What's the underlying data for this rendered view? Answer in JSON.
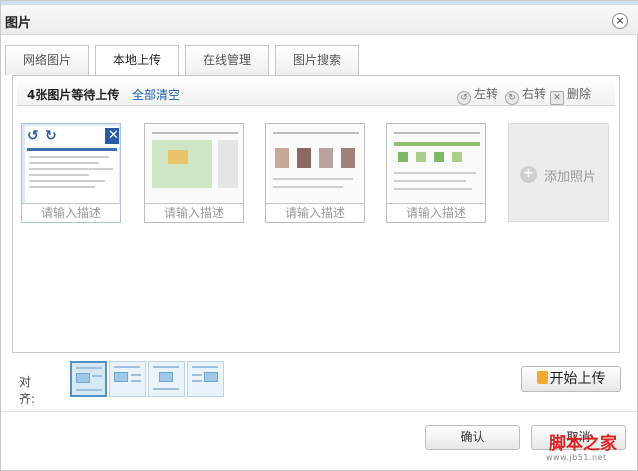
{
  "dialog": {
    "title": "图片",
    "close_glyph": "×"
  },
  "tabs": [
    {
      "label": "网络图片",
      "active": false
    },
    {
      "label": "本地上传",
      "active": true
    },
    {
      "label": "在线管理",
      "active": false
    },
    {
      "label": "图片搜索",
      "active": false
    }
  ],
  "toolbar": {
    "count_text": "4张图片等待上传",
    "clear_label": "全部清空",
    "left_rotate_label": "左转",
    "right_rotate_label": "右转",
    "delete_label": "删除"
  },
  "thumbnails": [
    {
      "placeholder": "请输入描述",
      "selected": true
    },
    {
      "placeholder": "请输入描述",
      "selected": false
    },
    {
      "placeholder": "请输入描述",
      "selected": false
    },
    {
      "placeholder": "请输入描述",
      "selected": false
    }
  ],
  "add_photo": {
    "label": "添加照片",
    "icon": "plus-icon"
  },
  "align": {
    "label": "对 齐:",
    "options": [
      "align-none",
      "align-left",
      "align-center",
      "align-right"
    ],
    "selected_index": 0
  },
  "upload_button": {
    "label": "开始上传",
    "icon": "upload-icon"
  },
  "footer": {
    "confirm_label": "确认",
    "cancel_label": "取消"
  },
  "watermark": {
    "text": "脚本之家",
    "sub": "www.jb51.net"
  },
  "colors": {
    "accent": "#2a5aa0",
    "link": "#1a5faa",
    "selected_thumb": "#dbe8f6"
  }
}
